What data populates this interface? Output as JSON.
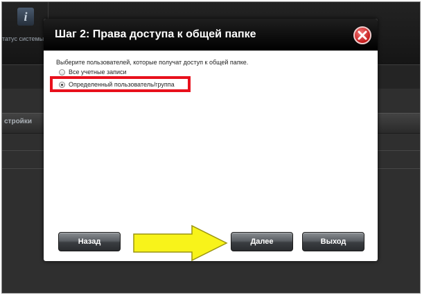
{
  "background": {
    "status_label": "татус системы",
    "section_label": "стройки"
  },
  "dialog": {
    "title": "Шаг 2: Права доступа к общей папке",
    "prompt": "Выберите пользователей, которые получат доступ к общей папке.",
    "options": [
      {
        "label": "Все учетные записи",
        "selected": false
      },
      {
        "label": "Определенный пользователь/группа",
        "selected": true
      }
    ],
    "buttons": {
      "back": "Назад",
      "next": "Далее",
      "exit": "Выход"
    }
  },
  "colors": {
    "highlight": "#e8101c",
    "arrow_fill": "#f8f31a",
    "close": "#c41b1b"
  },
  "icons": [
    "info-icon",
    "close-icon",
    "arrow-right-icon"
  ]
}
